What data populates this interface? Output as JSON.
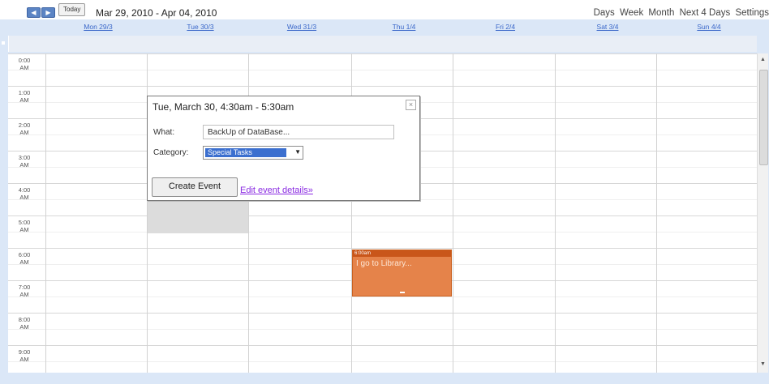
{
  "toolbar": {
    "prev_icon": "◀",
    "next_icon": "▶",
    "today_label": "Today",
    "date_range": "Mar 29, 2010 - Apr 04, 2010",
    "views": [
      "Days",
      "Week",
      "Month",
      "Next 4 Days",
      "Settings"
    ]
  },
  "days": [
    "Mon 29/3",
    "Tue 30/3",
    "Wed 31/3",
    "Thu 1/4",
    "Fri 2/4",
    "Sat 3/4",
    "Sun 4/4"
  ],
  "times": [
    [
      "0:00",
      "AM"
    ],
    [
      "1:00",
      "AM"
    ],
    [
      "2:00",
      "AM"
    ],
    [
      "3:00",
      "AM"
    ],
    [
      "4:00",
      "AM"
    ],
    [
      "5:00",
      "AM"
    ],
    [
      "6:00",
      "AM"
    ],
    [
      "7:00",
      "AM"
    ],
    [
      "8:00",
      "AM"
    ],
    [
      "9:00",
      "AM"
    ]
  ],
  "event": {
    "time": "6:00am",
    "title": "I go to Library..."
  },
  "popup": {
    "title": "Tue, March 30, 4:30am - 5:30am",
    "close_icon": "×",
    "what_label": "What:",
    "what_value": "BackUp of DataBase...",
    "category_label": "Category:",
    "category_value": "Special Tasks",
    "dropdown_icon": "▼",
    "create_label": "Create Event",
    "edit_link": "Edit event details»"
  },
  "colors": {
    "header_bg": "#dbe7f7",
    "event_bg": "#e5834a",
    "event_header": "#c9561a",
    "category_highlight": "#3b6fcf"
  }
}
